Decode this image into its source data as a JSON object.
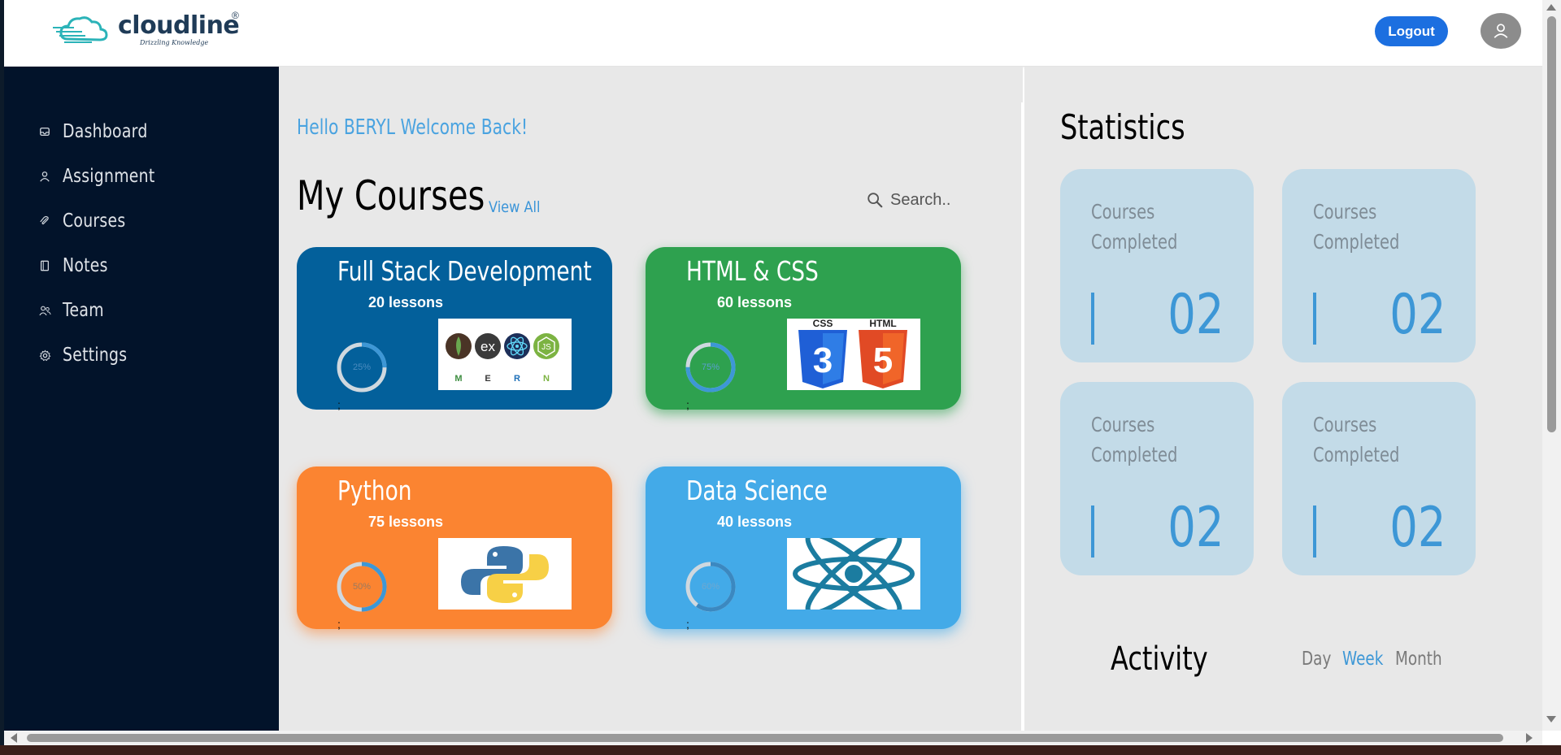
{
  "header": {
    "logo_text": "cloudline",
    "logo_reg": "®",
    "logo_tagline": "Drizzling Knowledge",
    "logout_label": "Logout",
    "avatar_icon": "user-icon"
  },
  "sidebar": {
    "items": [
      {
        "label": "Dashboard",
        "icon": "inbox-icon"
      },
      {
        "label": "Assignment",
        "icon": "user-icon"
      },
      {
        "label": "Courses",
        "icon": "paperclip-icon"
      },
      {
        "label": "Notes",
        "icon": "notebook-icon"
      },
      {
        "label": "Team",
        "icon": "team-icon"
      },
      {
        "label": "Settings",
        "icon": "gear-icon"
      }
    ]
  },
  "main": {
    "welcome": "Hello BERYL Welcome Back!",
    "courses_title": "My Courses",
    "view_all": "View All",
    "search_placeholder": "Search..",
    "courses": [
      {
        "title": "Full Stack Development",
        "lessons": "20 lessons",
        "progress_label": "25%",
        "progress": 0.25,
        "note": ";",
        "color": "#03609b",
        "thumb": "mern-logos"
      },
      {
        "title": "HTML & CSS",
        "lessons": "60 lessons",
        "progress_label": "75%",
        "progress": 0.75,
        "note": ";",
        "color": "#2ea14f",
        "thumb": "html-css-logos"
      },
      {
        "title": "Python",
        "lessons": "75 lessons",
        "progress_label": "50%",
        "progress": 0.5,
        "note": ";",
        "color": "#fb8431",
        "thumb": "python-logo"
      },
      {
        "title": "Data Science",
        "lessons": "40 lessons",
        "progress_label": "60%",
        "progress": 0.6,
        "note": ";",
        "color": "#43aae8",
        "thumb": "atom-logo"
      }
    ],
    "mern_letters": [
      "M",
      "E",
      "R",
      "N"
    ],
    "mern_ex": "ex",
    "mern_js": "JS",
    "css_label": "CSS",
    "html_label": "HTML",
    "css_number": "3",
    "html_number": "5"
  },
  "stats": {
    "title": "Statistics",
    "cards": [
      {
        "label": "Courses Completed",
        "value": "02"
      },
      {
        "label": "Courses Completed",
        "value": "02"
      },
      {
        "label": "Courses Completed",
        "value": "02"
      },
      {
        "label": "Courses Completed",
        "value": "02"
      }
    ],
    "activity_title": "Activity",
    "periods": [
      "Day",
      "Week",
      "Month"
    ],
    "active_period": "Week"
  },
  "colors": {
    "sidebar_bg": "#02132a",
    "accent": "#3d97d6",
    "logout": "#1c6fe0",
    "stat_card": "#c3dbe8"
  }
}
